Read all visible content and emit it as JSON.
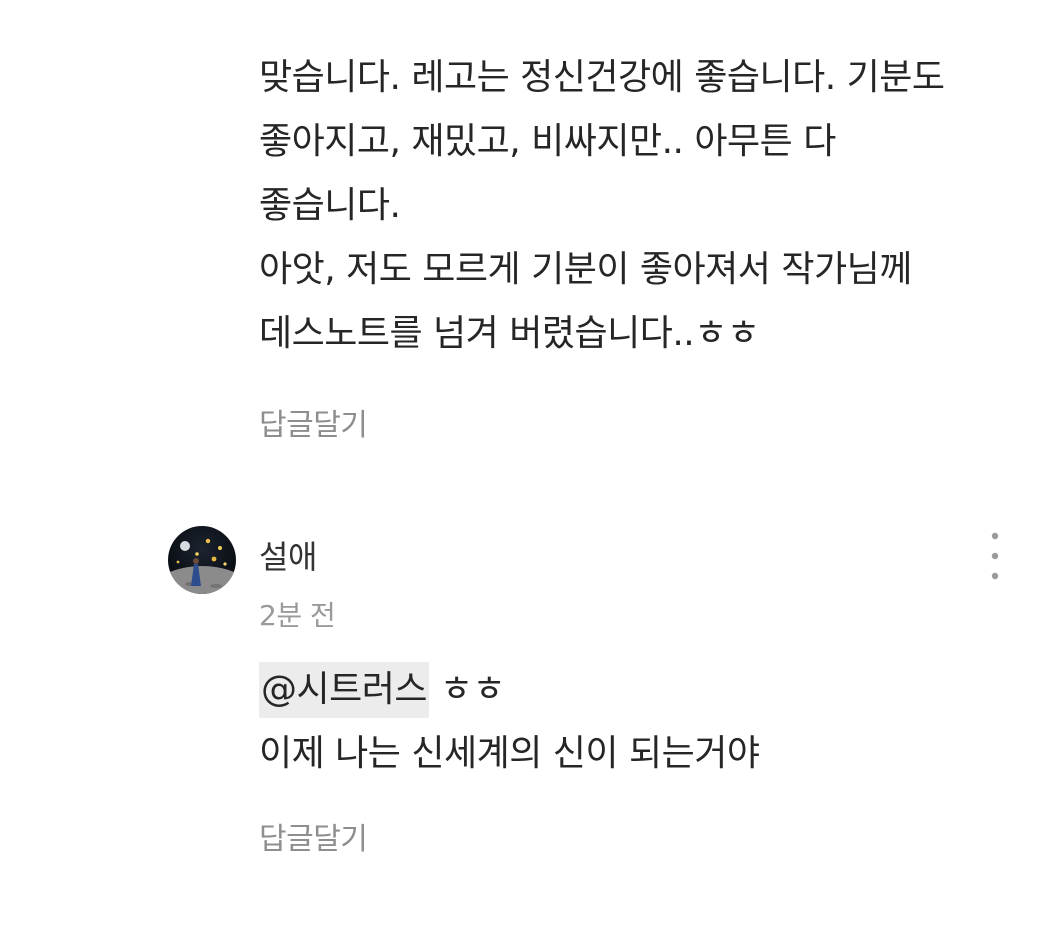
{
  "comment_prev": {
    "lines": [
      "맞습니다. 레고는 정신건강에 좋습니다. 기분도",
      "좋아지고, 재밌고, 비싸지만.. 아무튼 다",
      "좋습니다.",
      "아앗, 저도 모르게 기분이 좋아져서 작가님께",
      "데스노트를 넘겨 버렸습니다..ㅎㅎ"
    ],
    "reply_label": "답글달기"
  },
  "comment_current": {
    "avatar_icon": "profile-avatar-night-sky",
    "author": "설애",
    "timestamp": "2분 전",
    "more_icon": "more-vertical-icon",
    "mention": "@시트러스",
    "first_line_rest": " ㅎㅎ",
    "second_line": "이제 나는 신세계의 신이 되는거야",
    "reply_label": "답글달기"
  },
  "colors": {
    "text": "#262626",
    "muted": "#8e8e8e",
    "mention_bg": "#ececec"
  }
}
